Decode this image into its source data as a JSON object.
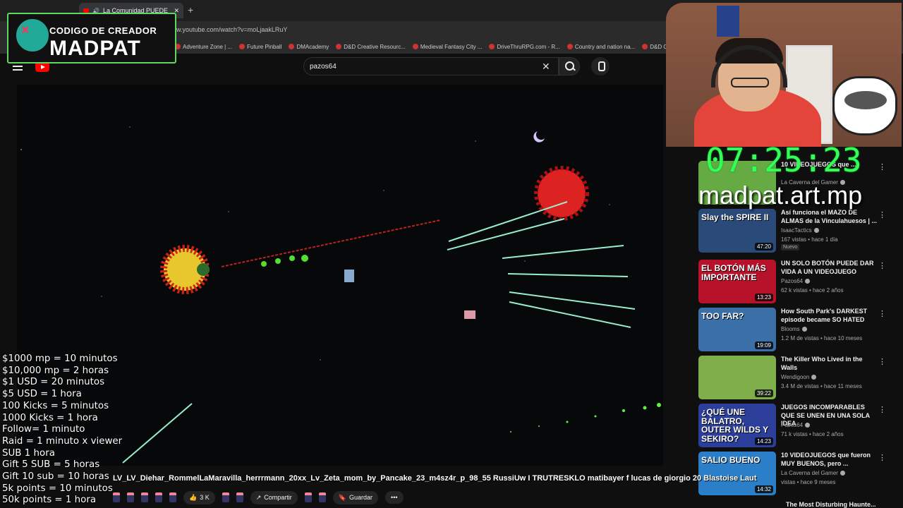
{
  "browser": {
    "tab_title": "La Comunidad PUEDE SAL",
    "new_tab_symbol": "+",
    "url": "w.youtube.com/watch?v=moLjaakLRuY",
    "bookmarks": [
      "Adventure Zone | ...",
      "Future Pinball",
      "DMAcademy",
      "D&D Creative Resourc...",
      "Medieval Fantasy City ...",
      "DriveThruRPG.com - R...",
      "Country and nation na...",
      "D&D Comp"
    ]
  },
  "creator_badge": {
    "line1": "CODIGO DE CREADOR",
    "line2": "MADPAT"
  },
  "youtube": {
    "search_value": "pazos64",
    "clear_symbol": "✕"
  },
  "overlay": {
    "timer": "07:25:23",
    "brand": "madpat.art.mp"
  },
  "prices": [
    "$1000 mp = 10 minutos",
    "$10,000 mp = 2 horas",
    "$1 USD = 20 minutos",
    "$5 USD = 1 hora",
    "100 Kicks = 5 minutos",
    "1000 Kicks = 1 hora",
    "Follow= 1 minuto",
    "Raid = 1 minuto x viewer",
    "SUB 1 hora",
    "Gift 5 SUB = 5 horas",
    "Gift 10 sub = 10 horas",
    "5k points = 10 minutos",
    "50k points = 1 hora"
  ],
  "recommendations": [
    {
      "title": "10 VIDEOJUEGOS que ...",
      "channel": "La Caverna del Gamer",
      "meta": "",
      "duration": "",
      "thumb_text": "",
      "thumb_color": "#6a4"
    },
    {
      "title": "Así funciona el MAZO DE ALMAS de la Vinculahuesos | ...",
      "channel": "IsaacTactics",
      "meta": "167 vistas • hace 1 día",
      "badge": "Nuevo",
      "duration": "47:20",
      "thumb_text": "Slay the SPIRE II",
      "thumb_color": "#2a4a7a"
    },
    {
      "title": "UN SOLO BOTÓN PUEDE DAR VIDA A UN VIDEOJUEGO",
      "channel": "Pazos64",
      "meta": "62 k vistas • hace 2 años",
      "duration": "13:23",
      "thumb_text": "EL BOTÓN MÁS IMPORTANTE",
      "thumb_color": "#b8122b"
    },
    {
      "title": "How South Park's DARKEST episode became SO HATED",
      "channel": "Blooms",
      "meta": "1.2 M de vistas • hace 10 meses",
      "duration": "19:09",
      "thumb_text": "TOO FAR?",
      "thumb_color": "#3a6fa8"
    },
    {
      "title": "The Killer Who Lived in the Walls",
      "channel": "Wendigoon",
      "meta": "3.4 M de vistas • hace 11 meses",
      "duration": "39:22",
      "thumb_text": "",
      "thumb_color": "#7fae4a"
    },
    {
      "title": "JUEGOS INCOMPARABLES QUE SE UNEN EN UNA SOLA IDEA",
      "channel": "Pazos64",
      "meta": "71 k vistas • hace 2 años",
      "duration": "14:23",
      "thumb_text": "¿QUÉ UNE BALATRO, OUTER WILDS Y SEKIRO?",
      "thumb_color": "#2b3e9a"
    },
    {
      "title": "10 VIDEOJUEGOS que fueron MUY BUENOS, pero ...",
      "channel": "La Caverna del Gamer",
      "meta": "vistas • hace 9 meses",
      "duration": "14:32",
      "thumb_text": "SALIO BUENO",
      "thumb_color": "#2a7fc8"
    }
  ],
  "chat_ticker": "LV_LV_Diehar_RommelLaMaravilla_herrrmann_20xx_Lv_Zeta_mom_by_Pancake_23_m4sz4r_p_98_55    RussiUw I TRUTRESKLO          matibayer f lucas de giorgio 20    Blastoise Laut",
  "bottom_bar": {
    "likes": "3 K",
    "share": "Compartir",
    "save": "Guardar",
    "more": "•••"
  },
  "sidebar_bottom_title": "The Most Disturbing Haunte..."
}
